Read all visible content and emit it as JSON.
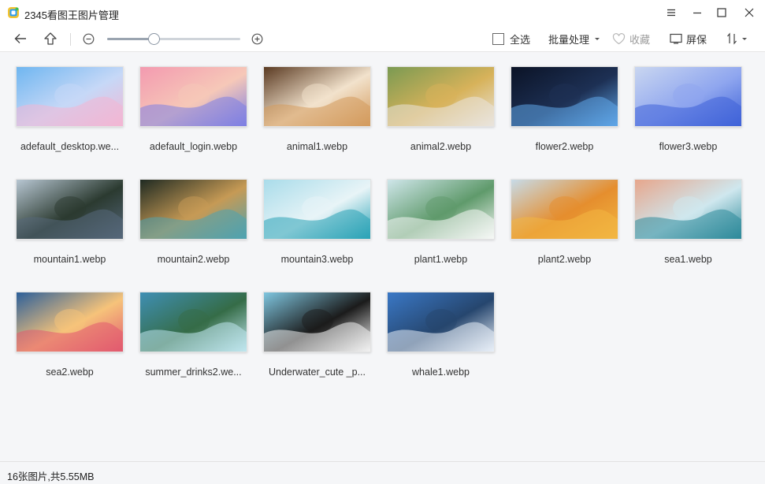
{
  "window": {
    "title": "2345看图王图片管理",
    "logo_icon": "app-logo-icon",
    "controls": [
      "menu-icon",
      "minimize-icon",
      "maximize-icon",
      "close-icon"
    ]
  },
  "toolbar": {
    "back_icon": "arrow-left-icon",
    "up_icon": "arrow-up-icon",
    "zoom_out_icon": "zoom-out-icon",
    "zoom_in_icon": "zoom-in-icon",
    "zoom_level": 0.35,
    "select_all_label": "全选",
    "batch_label": "批量处理",
    "favorite_label": "收藏",
    "screen_label": "屏保",
    "sort_icon": "sort-icon"
  },
  "images": [
    {
      "name": "adefault_desktop.we...",
      "palette": [
        "#6fb6f0",
        "#f3b6d3",
        "#c6d8f7"
      ]
    },
    {
      "name": "adefault_login.webp",
      "palette": [
        "#f39ab0",
        "#7d7fe3",
        "#f6c8b8"
      ]
    },
    {
      "name": "animal1.webp",
      "palette": [
        "#5a3a22",
        "#d39a5c",
        "#f2e2cc"
      ]
    },
    {
      "name": "animal2.webp",
      "palette": [
        "#7a9a52",
        "#e9e4dc",
        "#d7b25a"
      ]
    },
    {
      "name": "flower2.webp",
      "palette": [
        "#0b1326",
        "#5fa6e8",
        "#1d3054"
      ]
    },
    {
      "name": "flower3.webp",
      "palette": [
        "#c9d6f0",
        "#3f63d8",
        "#8fa6ef"
      ]
    },
    {
      "name": "mountain1.webp",
      "palette": [
        "#b7c6d2",
        "#55677a",
        "#2b3a30"
      ]
    },
    {
      "name": "mountain2.webp",
      "palette": [
        "#1f2a22",
        "#4fa3b0",
        "#c69a55"
      ]
    },
    {
      "name": "mountain3.webp",
      "palette": [
        "#a9dcea",
        "#2aa3b6",
        "#e8f4f7"
      ]
    },
    {
      "name": "plant1.webp",
      "palette": [
        "#cfe6ea",
        "#f5f7f5",
        "#5f9a6b"
      ]
    },
    {
      "name": "plant2.webp",
      "palette": [
        "#c7dbe8",
        "#f2b741",
        "#e58e2e"
      ]
    },
    {
      "name": "sea1.webp",
      "palette": [
        "#e7a68c",
        "#2e8a9a",
        "#cfe7ee"
      ]
    },
    {
      "name": "sea2.webp",
      "palette": [
        "#2c5f9a",
        "#e25a6f",
        "#f6c37a"
      ]
    },
    {
      "name": "summer_drinks2.we...",
      "palette": [
        "#3f8fb4",
        "#bfe6ee",
        "#356c47"
      ]
    },
    {
      "name": "Underwater_cute _p...",
      "palette": [
        "#7fc6e0",
        "#f2f2f2",
        "#1b1b1b"
      ]
    },
    {
      "name": "whale1.webp",
      "palette": [
        "#3a78c6",
        "#e7eef7",
        "#26466e"
      ]
    }
  ],
  "status": {
    "text": "16张图片,共5.55MB"
  }
}
